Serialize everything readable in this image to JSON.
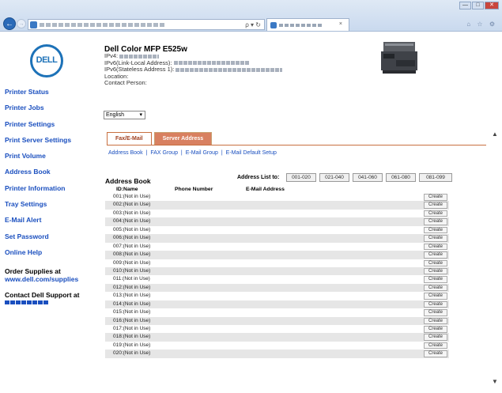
{
  "browser": {
    "window_controls": [
      "—",
      "□",
      "✕"
    ],
    "back_glyph": "←",
    "forward_glyph": "→",
    "address_tools": "ρ ▾ ↻",
    "tab_close": "×",
    "toolbar_icons": "⌂ ☆ ⚙"
  },
  "logo": "DELL",
  "sidebar": {
    "items": [
      {
        "label": "Printer Status"
      },
      {
        "label": "Printer Jobs"
      },
      {
        "label": "Printer Settings"
      },
      {
        "label": "Print Server Settings"
      },
      {
        "label": "Print Volume"
      },
      {
        "label": "Address Book"
      },
      {
        "label": "Printer Information"
      },
      {
        "label": "Tray Settings"
      },
      {
        "label": "E-Mail Alert"
      },
      {
        "label": "Set Password"
      },
      {
        "label": "Online Help"
      }
    ],
    "order_supplies": "Order Supplies at",
    "supplies_url": "www.dell.com/supplies",
    "contact_support": "Contact Dell Support at"
  },
  "printer": {
    "model": "Dell Color MFP E525w",
    "ipv4_label": "IPv4:",
    "ipv6_link_label": "IPv6(Link-Local Address):",
    "ipv6_stateless_label": "IPv6(Stateless Address 1):",
    "location_label": "Location:",
    "contact_label": "Contact Person:"
  },
  "language": {
    "selected": "English",
    "arrow": "▾"
  },
  "tabs": [
    {
      "label": "Fax/E-Mail",
      "active": true
    },
    {
      "label": "Server Address",
      "active": false
    }
  ],
  "sublinks": [
    "Address Book",
    "FAX Group",
    "E-Mail Group",
    "E-Mail Default Setup"
  ],
  "sublink_separator": "|",
  "address_book": {
    "title": "Address Book",
    "list_to_label": "Address List to:",
    "ranges": [
      "001-020",
      "021-040",
      "041-060",
      "061-080",
      "081-099"
    ],
    "columns": [
      "ID:Name",
      "Phone Number",
      "E-Mail Address"
    ],
    "create_label": "Create",
    "rows": [
      "001:(Not in Use)",
      "002:(Not in Use)",
      "003:(Not in Use)",
      "004:(Not in Use)",
      "005:(Not in Use)",
      "006:(Not in Use)",
      "007:(Not in Use)",
      "008:(Not in Use)",
      "009:(Not in Use)",
      "010:(Not in Use)",
      "011:(Not in Use)",
      "012:(Not in Use)",
      "013:(Not in Use)",
      "014:(Not in Use)",
      "015:(Not in Use)",
      "016:(Not in Use)",
      "017:(Not in Use)",
      "018:(Not in Use)",
      "019:(Not in Use)",
      "020:(Not in Use)"
    ]
  },
  "scrollbar": {
    "up": "▲",
    "down": "▼"
  }
}
